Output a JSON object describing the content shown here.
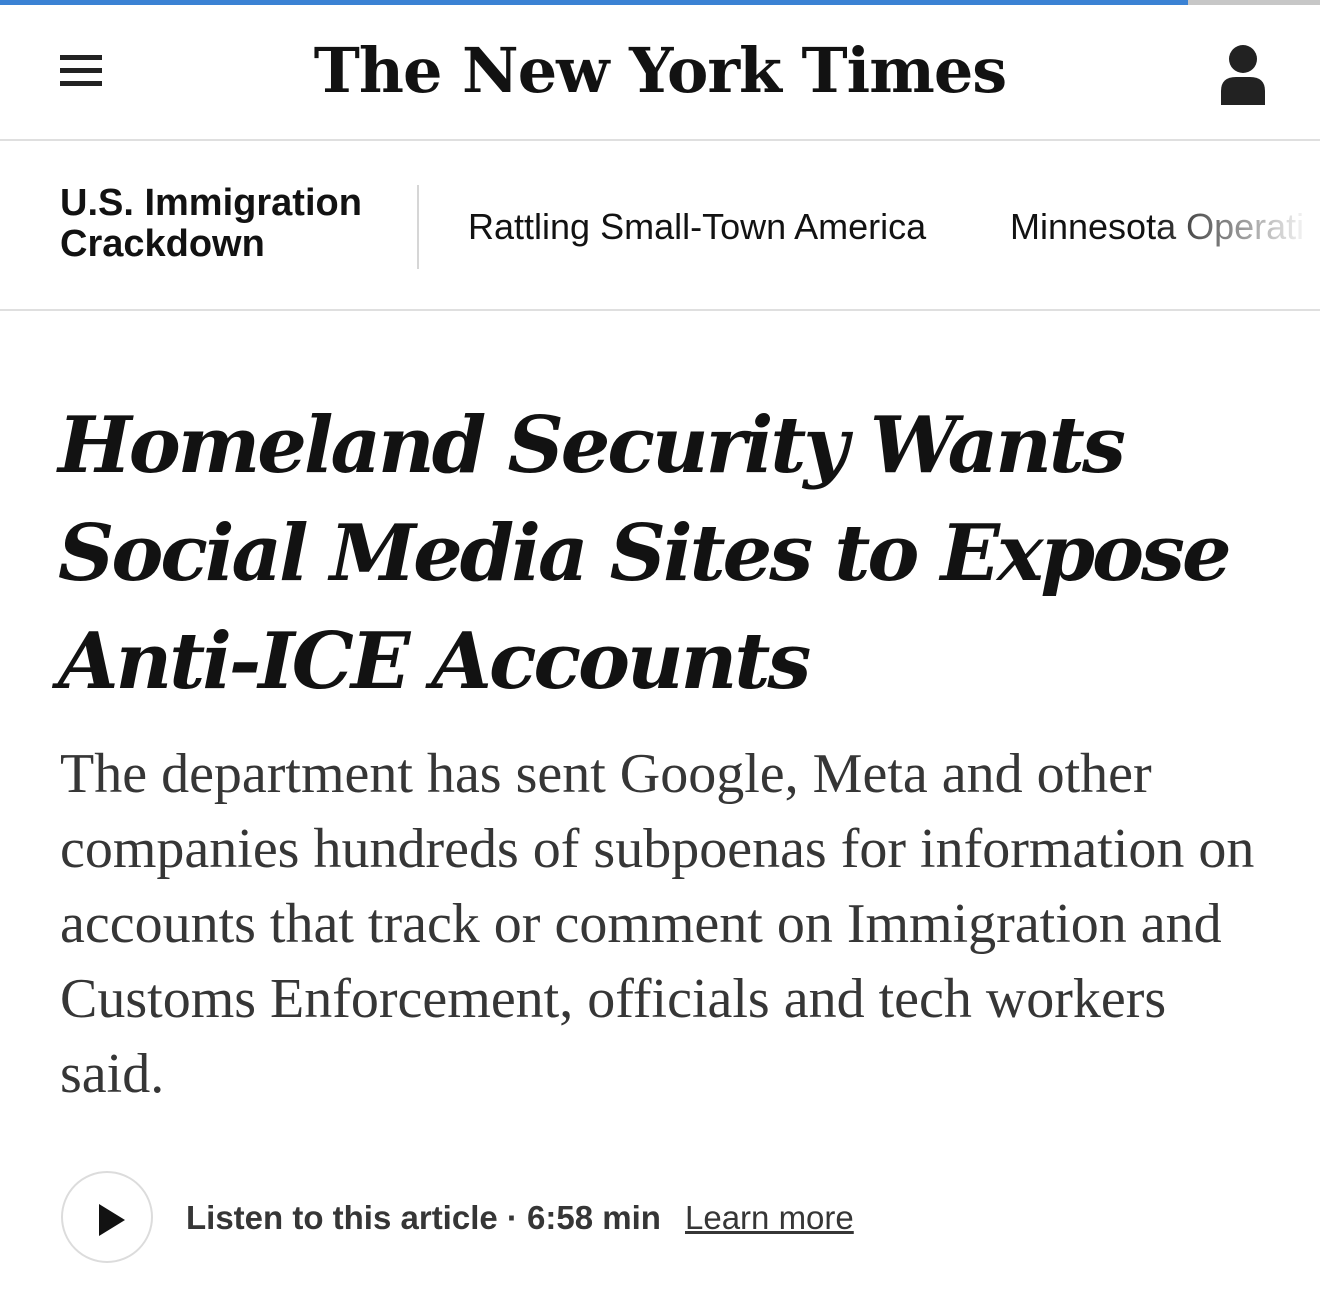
{
  "reading_progress": 0.9,
  "colors": {
    "progress_fill": "#3b82d4",
    "progress_track": "#c7c7c7",
    "text": "#121212",
    "summary_text": "#363636"
  },
  "masthead": {
    "menu_icon": "hamburger-menu-icon",
    "logo": "The New York Times",
    "account_icon": "person-icon"
  },
  "subnav": {
    "section_title": "U.S. Immigration Crackdown",
    "links": [
      "Rattling Small-Town America",
      "Minnesota Operati"
    ]
  },
  "article": {
    "headline": "Homeland Security Wants Social Media Sites to Expose Anti-ICE Accounts",
    "summary": "The department has sent Google, Meta and other companies hundreds of subpoenas for information on accounts that track or comment on Immigration and Customs Enforcement, officials and tech workers said."
  },
  "audio": {
    "play_icon": "play-icon",
    "label": "Listen to this article · 6:58 min",
    "learn_more": "Learn more"
  }
}
